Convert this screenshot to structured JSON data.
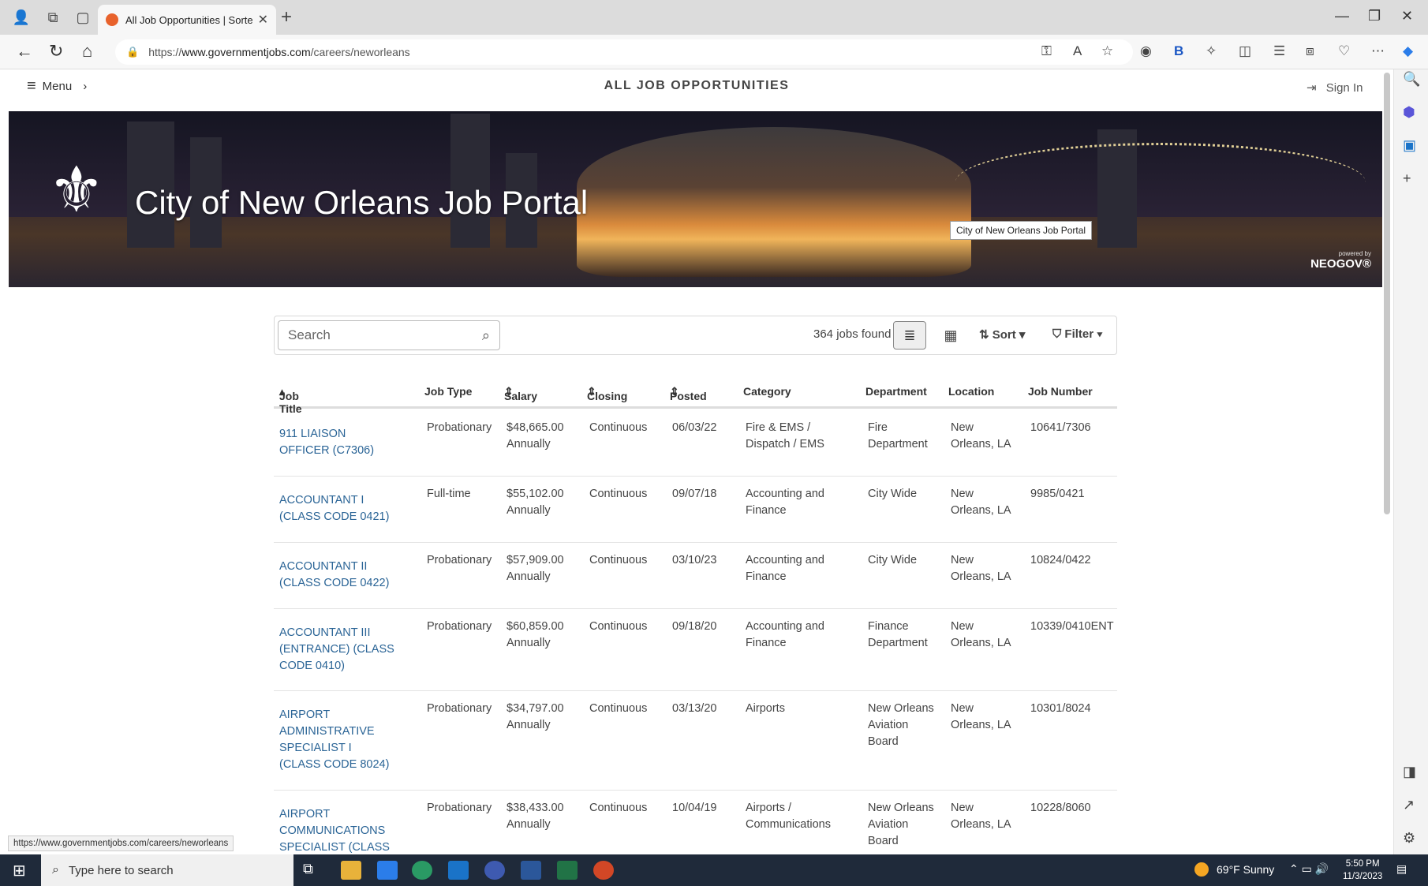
{
  "browser": {
    "tab_title": "All Job Opportunities | Sorted by",
    "url_prefix": "https://",
    "url_main": "www.governmentjobs.com",
    "url_path": "/careers/neworleans",
    "status_url": "https://www.governmentjobs.com/careers/neworleans"
  },
  "header": {
    "menu_label": "Menu",
    "page_title": "ALL JOB OPPORTUNITIES",
    "signin_label": "Sign In"
  },
  "banner": {
    "title": "City of New Orleans Job Portal",
    "tooltip": "City of New Orleans Job Portal",
    "powered_by": "powered by",
    "neogov": "NEOGOV®"
  },
  "toolbar": {
    "search_placeholder": "Search",
    "jobs_found": "364 jobs found",
    "sort_label": "Sort",
    "filter_label": "Filter"
  },
  "table": {
    "columns": [
      "Job Title",
      "Job Type",
      "Salary",
      "Closing",
      "Posted",
      "Category",
      "Department",
      "Location",
      "Job Number"
    ],
    "rows": [
      {
        "title": "911 LIAISON OFFICER (C7306)",
        "type": "Probationary",
        "salary": "$48,665.00 Annually",
        "closing": "Continuous",
        "posted": "06/03/22",
        "category": "Fire & EMS / Dispatch / EMS",
        "department": "Fire Department",
        "location": "New Orleans, LA",
        "number": "10641/7306"
      },
      {
        "title": "ACCOUNTANT I (CLASS CODE 0421)",
        "type": "Full-time",
        "salary": "$55,102.00 Annually",
        "closing": "Continuous",
        "posted": "09/07/18",
        "category": "Accounting and Finance",
        "department": "City Wide",
        "location": "New Orleans, LA",
        "number": "9985/0421"
      },
      {
        "title": "ACCOUNTANT II (CLASS CODE 0422)",
        "type": "Probationary",
        "salary": "$57,909.00 Annually",
        "closing": "Continuous",
        "posted": "03/10/23",
        "category": "Accounting and Finance",
        "department": "City Wide",
        "location": "New Orleans, LA",
        "number": "10824/0422"
      },
      {
        "title": "ACCOUNTANT III (ENTRANCE) (CLASS CODE 0410)",
        "type": "Probationary",
        "salary": "$60,859.00 Annually",
        "closing": "Continuous",
        "posted": "09/18/20",
        "category": "Accounting and Finance",
        "department": "Finance Department",
        "location": "New Orleans, LA",
        "number": "10339/0410ENT"
      },
      {
        "title": "AIRPORT ADMINISTRATIVE SPECIALIST I (CLASS CODE 8024)",
        "type": "Probationary",
        "salary": "$34,797.00 Annually",
        "closing": "Continuous",
        "posted": "03/13/20",
        "category": "Airports",
        "department": "New Orleans Aviation Board",
        "location": "New Orleans, LA",
        "number": "10301/8024"
      },
      {
        "title": "AIRPORT COMMUNICATIONS SPECIALIST (CLASS CODE",
        "type": "Probationary",
        "salary": "$38,433.00 Annually",
        "closing": "Continuous",
        "posted": "10/04/19",
        "category": "Airports / Communications",
        "department": "New Orleans Aviation Board",
        "location": "New Orleans, LA",
        "number": "10228/8060"
      }
    ]
  },
  "taskbar": {
    "search_placeholder": "Type here to search",
    "weather": "69°F  Sunny",
    "time": "5:50 PM",
    "date": "11/3/2023"
  },
  "colors": {
    "link": "#2a6496",
    "taskbar": "#1f2a3a",
    "accent_tab_icon": "#e8622c"
  }
}
